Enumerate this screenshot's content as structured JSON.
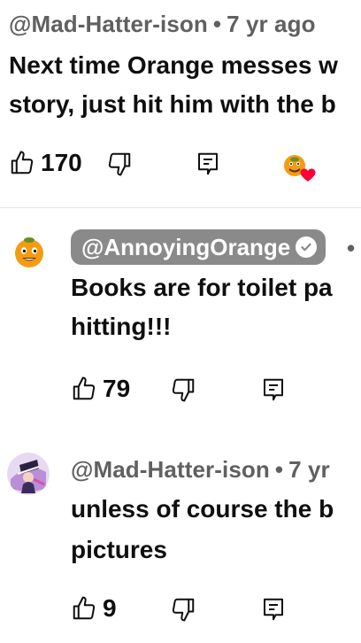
{
  "top_comment": {
    "handle": "@Mad-Hatter-ison",
    "separator": "•",
    "age": "7 yr ago",
    "text_line1": "Next time Orange messes w",
    "text_line2": "story, just hit him with the b",
    "like_count": "170",
    "icons": {
      "like": "thumbs-up-icon",
      "dislike": "thumbs-down-icon",
      "reply": "reply-icon",
      "creator_heart": "creator-heart-icon"
    }
  },
  "replies": [
    {
      "handle": "@AnnoyingOrange",
      "verified": true,
      "separator": "•",
      "text_line1": "Books are for toilet pa",
      "text_line2": "hitting!!!",
      "like_count": "79"
    },
    {
      "handle": "@Mad-Hatter-ison",
      "separator": "•",
      "age": "7 yr",
      "text_line1": "unless of course the b",
      "text_line2": "pictures",
      "like_count": "9"
    }
  ],
  "colors": {
    "text": "#0f0f0f",
    "meta": "#606060",
    "pill": "#8a8a8a",
    "heart": "#ff0033",
    "orange": "#f39c12"
  }
}
